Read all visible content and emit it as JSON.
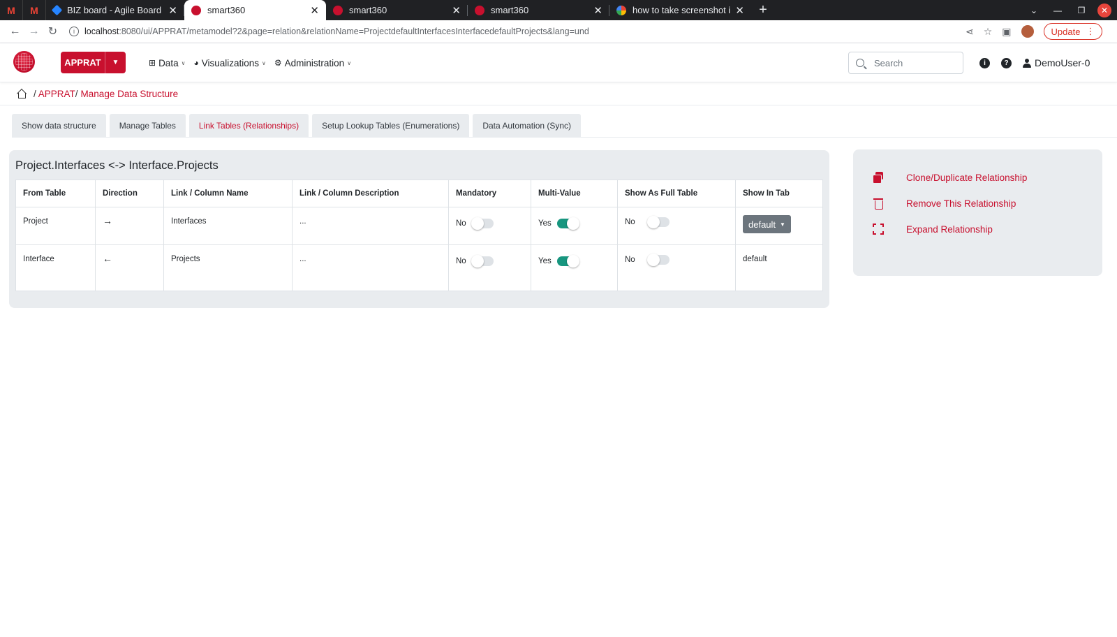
{
  "browser": {
    "tabs": [
      {
        "label": "BIZ board - Agile Board - J",
        "icon": "jira-icon",
        "color": "#2684ff",
        "active": false
      },
      {
        "label": "smart360",
        "icon": "smart360-icon",
        "color": "#c8102e",
        "active": true
      },
      {
        "label": "smart360",
        "icon": "smart360-icon",
        "color": "#c8102e",
        "active": false
      },
      {
        "label": "smart360",
        "icon": "smart360-icon",
        "color": "#c8102e",
        "active": false
      },
      {
        "label": "how to take screenshot in",
        "icon": "google-icon",
        "color": "#4285f4",
        "active": false
      }
    ],
    "url_host": "localhost",
    "url_rest": ":8080/ui/APPRAT/metamodel?2&page=relation&relationName=ProjectdefaultInterfacesInterfacedefaultProjects&lang=und",
    "update_label": "Update"
  },
  "navbar": {
    "app_button": "APPRAT",
    "menu": [
      {
        "label": "Data",
        "icon": "sitemap-icon"
      },
      {
        "label": "Visualizations",
        "icon": "pie-chart-icon"
      },
      {
        "label": "Administration",
        "icon": "gears-icon"
      }
    ],
    "search_placeholder": "Search",
    "user": "DemoUser-0"
  },
  "breadcrumb": {
    "sep": "/",
    "app": "APPRAT",
    "page": "Manage Data Structure"
  },
  "tabs": [
    {
      "label": "Show data structure",
      "active": false
    },
    {
      "label": "Manage Tables",
      "active": false
    },
    {
      "label": "Link Tables (Relationships)",
      "active": true
    },
    {
      "label": "Setup Lookup Tables (Enumerations)",
      "active": false
    },
    {
      "label": "Data Automation (Sync)",
      "active": false
    }
  ],
  "relation": {
    "title": "Project.Interfaces <-> Interface.Projects",
    "columns": [
      "From Table",
      "Direction",
      "Link / Column Name",
      "Link / Column Description",
      "Mandatory",
      "Multi-Value",
      "Show As Full Table",
      "Show In Tab"
    ],
    "rows": [
      {
        "from": "Project",
        "direction": "→",
        "name": "Interfaces",
        "description": "...",
        "mandatory": "No",
        "mandatory_on": false,
        "multi": "Yes",
        "multi_on": true,
        "full": "No",
        "full_on": false,
        "tab": "default"
      },
      {
        "from": "Interface",
        "direction": "←",
        "name": "Projects",
        "description": "...",
        "mandatory": "No",
        "mandatory_on": false,
        "multi": "Yes",
        "multi_on": true,
        "full": "No",
        "full_on": false,
        "tab": "default"
      }
    ]
  },
  "actions": [
    {
      "label": "Clone/Duplicate Relationship",
      "icon": "clone-icon"
    },
    {
      "label": "Remove This Relationship",
      "icon": "trash-icon"
    },
    {
      "label": "Expand Relationship",
      "icon": "expand-icon"
    }
  ],
  "colors": {
    "accent": "#c8102e",
    "toggle_on": "#17967f"
  }
}
